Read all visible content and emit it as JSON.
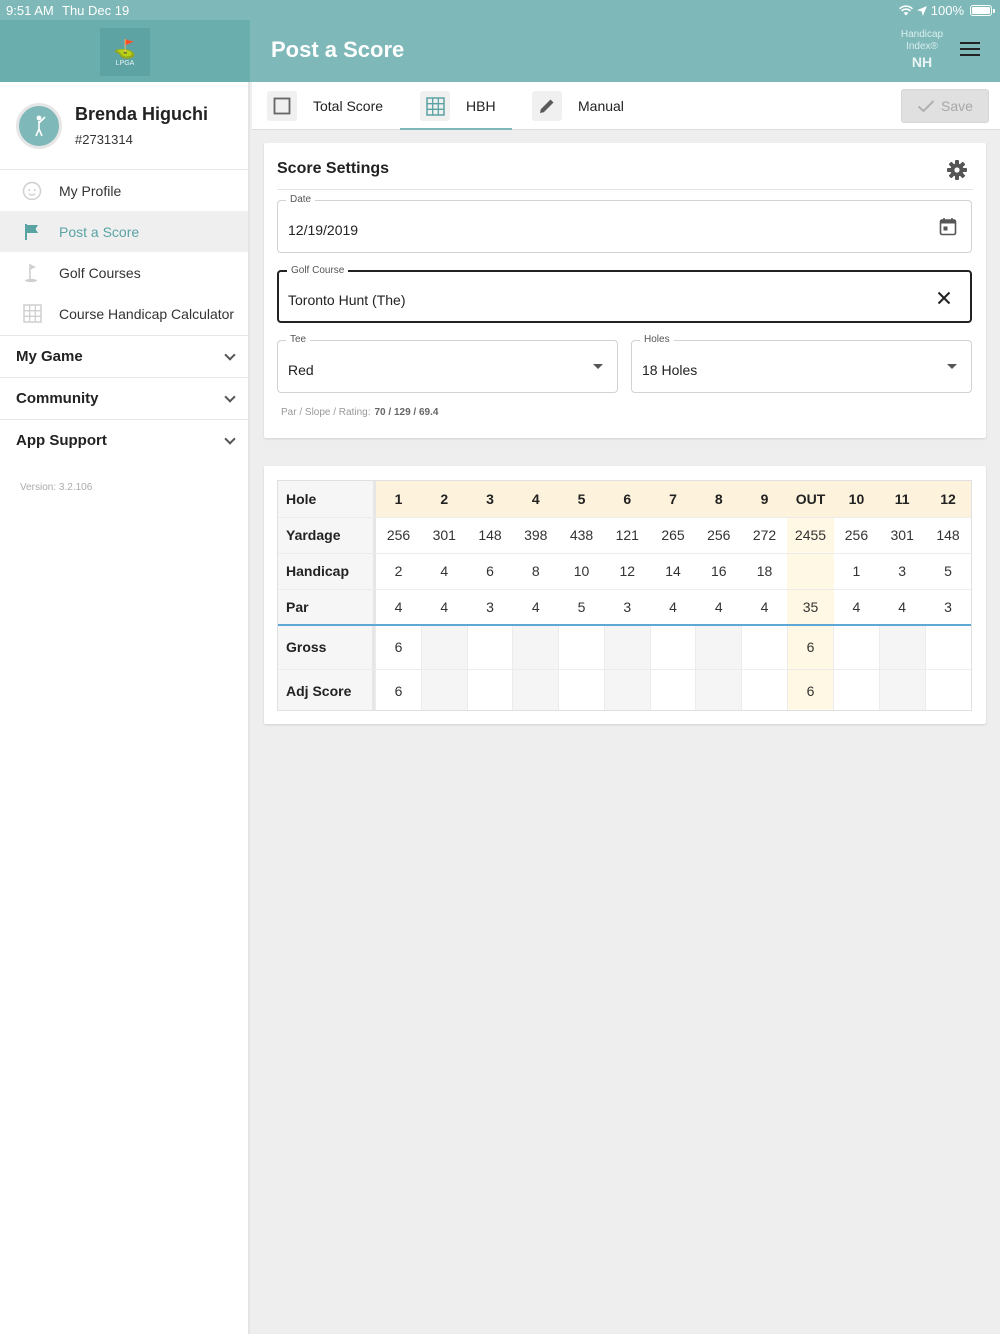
{
  "status": {
    "time": "9:51 AM",
    "date": "Thu Dec 19",
    "battery": "100%"
  },
  "logo": {
    "text": "LPGA"
  },
  "header": {
    "title": "Post a Score",
    "handicap_label": "Handicap Index®",
    "handicap_value": "NH"
  },
  "profile": {
    "name": "Brenda Higuchi",
    "id": "#2731314",
    "avatar_text": "LPGA"
  },
  "nav": {
    "items": [
      {
        "label": "My Profile",
        "icon": "face-icon"
      },
      {
        "label": "Post a Score",
        "icon": "flag-icon",
        "active": true
      },
      {
        "label": "Golf Courses",
        "icon": "golf-pin-icon"
      },
      {
        "label": "Course Handicap Calculator",
        "icon": "grid-icon"
      }
    ],
    "groups": [
      {
        "label": "My Game"
      },
      {
        "label": "Community"
      },
      {
        "label": "App Support"
      }
    ],
    "version": "Version: 3.2.106"
  },
  "tabs": [
    {
      "label": "Total Score",
      "icon": "checkbox-icon"
    },
    {
      "label": "HBH",
      "icon": "grid-icon",
      "active": true
    },
    {
      "label": "Manual",
      "icon": "pencil-icon"
    }
  ],
  "save_label": "Save",
  "settings": {
    "title": "Score Settings",
    "date": {
      "label": "Date",
      "value": "12/19/2019"
    },
    "course": {
      "label": "Golf Course",
      "value": "Toronto Hunt (The)"
    },
    "tee": {
      "label": "Tee",
      "value": "Red"
    },
    "holes": {
      "label": "Holes",
      "value": "18 Holes"
    },
    "psr_label": "Par / Slope / Rating:",
    "psr_value": "70 / 129 / 69.4"
  },
  "scorecard": {
    "columns": [
      "1",
      "2",
      "3",
      "4",
      "5",
      "6",
      "7",
      "8",
      "9",
      "OUT",
      "10",
      "11",
      "12"
    ],
    "rows": [
      {
        "label": "Hole",
        "type": "head"
      },
      {
        "label": "Yardage",
        "values": [
          "256",
          "301",
          "148",
          "398",
          "438",
          "121",
          "265",
          "256",
          "272",
          "2455",
          "256",
          "301",
          "148"
        ]
      },
      {
        "label": "Handicap",
        "values": [
          "2",
          "4",
          "6",
          "8",
          "10",
          "12",
          "14",
          "16",
          "18",
          "",
          "1",
          "3",
          "5"
        ]
      },
      {
        "label": "Par",
        "values": [
          "4",
          "4",
          "3",
          "4",
          "5",
          "3",
          "4",
          "4",
          "4",
          "35",
          "4",
          "4",
          "3"
        ]
      },
      {
        "label": "Gross",
        "type": "entry",
        "values": [
          "6",
          "",
          "",
          "",
          "",
          "",
          "",
          "",
          "",
          "6",
          "",
          "",
          ""
        ]
      },
      {
        "label": "Adj Score",
        "type": "entry",
        "values": [
          "6",
          "",
          "",
          "",
          "",
          "",
          "",
          "",
          "",
          "6",
          "",
          "",
          ""
        ]
      }
    ]
  }
}
